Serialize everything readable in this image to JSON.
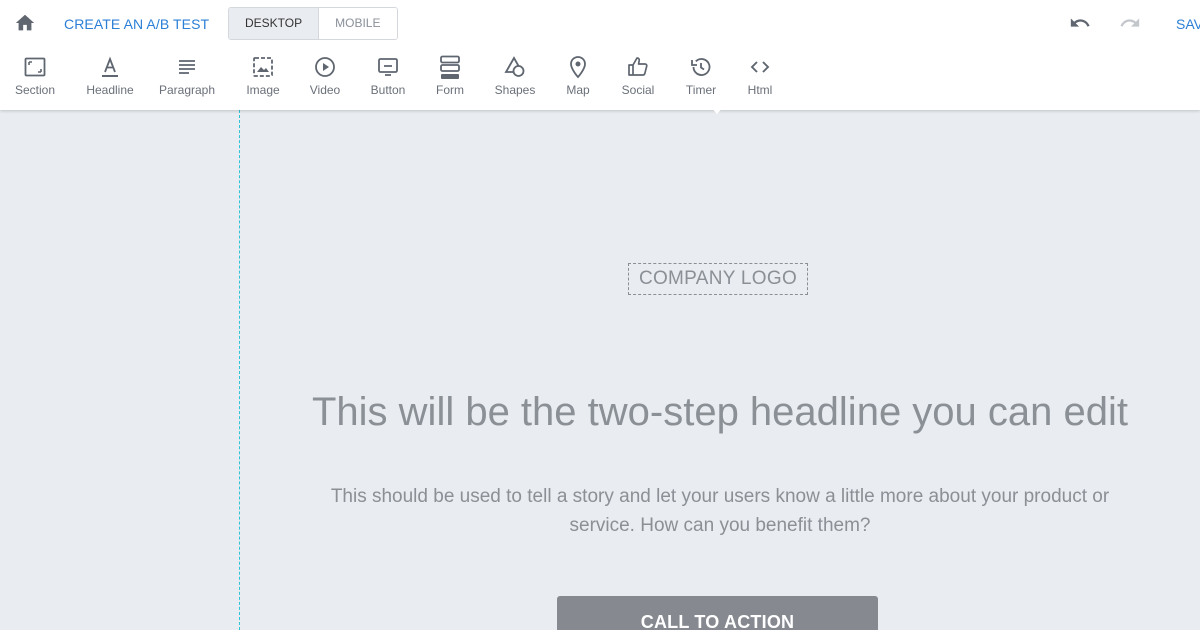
{
  "header": {
    "ab_test_link": "CREATE AN A/B TEST",
    "device_tabs": [
      "DESKTOP",
      "MOBILE"
    ],
    "save_label": "SAVE"
  },
  "tools": [
    {
      "label": "Section",
      "icon": "section-icon"
    },
    {
      "label": "Headline",
      "icon": "headline-icon"
    },
    {
      "label": "Paragraph",
      "icon": "paragraph-icon"
    },
    {
      "label": "Image",
      "icon": "image-icon"
    },
    {
      "label": "Video",
      "icon": "video-icon"
    },
    {
      "label": "Button",
      "icon": "button-icon"
    },
    {
      "label": "Form",
      "icon": "form-icon"
    },
    {
      "label": "Shapes",
      "icon": "shapes-icon"
    },
    {
      "label": "Map",
      "icon": "map-icon"
    },
    {
      "label": "Social",
      "icon": "social-icon"
    },
    {
      "label": "Timer",
      "icon": "timer-icon"
    },
    {
      "label": "Html",
      "icon": "html-icon"
    }
  ],
  "canvas": {
    "logo_text": "COMPANY LOGO",
    "headline": "This will be the two-step headline you can edit",
    "subtext": "This should be used to tell a story and let your users know a little more about your product or service. How can you benefit them?",
    "cta": "CALL TO ACTION"
  },
  "colors": {
    "accent": "#2b7fd6",
    "canvas_bg": "#e9ecf0",
    "guide_line": "#2ec4d8",
    "cta_bg": "#868a90"
  }
}
